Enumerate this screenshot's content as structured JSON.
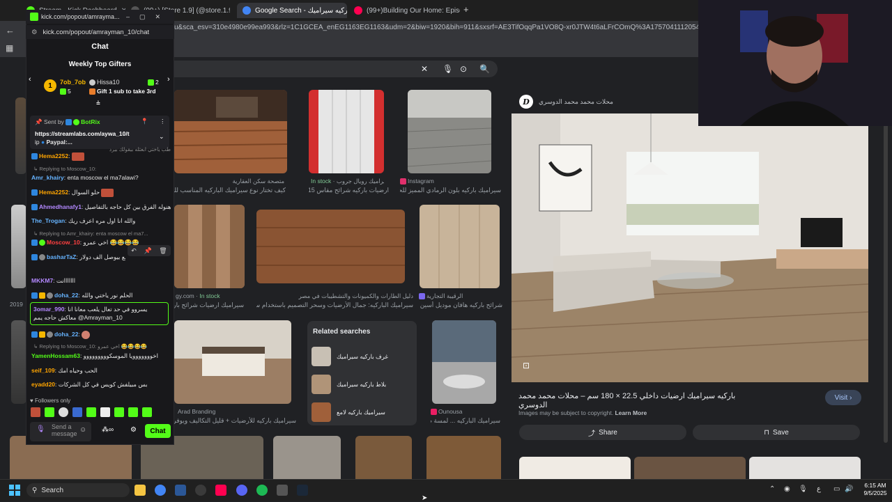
{
  "browser": {
    "tabs": [
      {
        "title": "Stream - Kick Dashboard",
        "color": "#53fc18"
      },
      {
        "title": "(99+) [Store 1.9] (@store.1.9) | Tik",
        "color": "#555"
      },
      {
        "title": "Google Search - باركيه سيراميك",
        "color": "#4285f4"
      },
      {
        "title": "(99+)Building Our Home: Episo",
        "color": "#ff0050"
      }
    ],
    "url": "u&sca_esv=310e4980e99ea993&rlz=1C1GCEA_enEG1163EG1163&udm=2&biw=1920&bih=911&sxsrf=AE3TifOqqPa1VO8Q-xr0JTW4t6aLFrCOmQ%3A1757041112054&ei=2FG6aPS"
  },
  "google": {
    "results": [
      {
        "caption": "كيف تختار نوع سيراميك الباركيه المناسب لك وكيف يتم ...",
        "source": "متصحة سكن العقارية"
      },
      {
        "caption": "ارضيات باركيه شرائح مقاس 15* ...",
        "source": "سيراميك رويال جروب",
        "badge": "In stock"
      },
      {
        "caption": "سيراميك باركيه بلون الرمادي المميز للحصول ...",
        "source": "Instagram"
      },
      {
        "caption": "سيراميك ارضيات شرائح باركيه ...",
        "source": "gy.com",
        "badge": "In stock"
      },
      {
        "caption": "سيراميك الباركيه: جمال الأرضيات وسحر التصميم باستخدام سيراميك ...",
        "source": "دليل الطارات والكميونات والتشطيبات في مصر"
      },
      {
        "caption": "شرائح باركيه هافان موديل أسين 5 ...",
        "source": "الرقيبة التجارية"
      },
      {
        "caption": "سيراميك باركيه للأرضيات + قليل التكاليف ويوفر المسا ...",
        "source": "Arad Branding"
      },
      {
        "caption": "سيراميك الباركيه ... لمسة م ...",
        "source": "Ounousa"
      }
    ],
    "left_edge_caption": "2019",
    "related": {
      "title": "Related searches",
      "items": [
        "غرف باركيه سيراميك",
        "بلاط باركيه سيراميك",
        "سيراميك باركيه لامع"
      ]
    },
    "preview": {
      "site_logo": "D",
      "site": "محلات محمد محمد الدوسري",
      "title": "باركيه سيراميك ارضيات داخلي 22.5 × 180 سم – محلات محمد محمد الدوسري",
      "visit": "Visit",
      "copyright": "Images may be subject to copyright.",
      "learn_more": "Learn More",
      "share": "Share",
      "save": "Save"
    }
  },
  "chat": {
    "window_title": "kick.com/popout/amrayma...",
    "url": "kick.com/popout/amrayman_10/chat",
    "header": "Chat",
    "gifters": {
      "title": "Weekly Top Gifters",
      "first": {
        "rank": "1",
        "name": "7ob_7ob",
        "count": "5"
      },
      "second": {
        "name": "Hissa10",
        "count": "2",
        "note": "Gift 1 sub to take 3rd"
      }
    },
    "pinned": {
      "sent_by": "Sent by",
      "bot": "BotRix",
      "link": "https://streamlabs.com/aywa_10/t",
      "rest": "ip",
      "paypal": "Paypal:..."
    },
    "messages": [
      {
        "type": "reply",
        "text": "طب ياختي ابعثله بيقولك بيرد"
      },
      {
        "type": "msg",
        "user": "Hema2252",
        "color": "#ffa500",
        "text": ""
      },
      {
        "type": "reply",
        "text": "Replying to Moscow_10:"
      },
      {
        "type": "msg",
        "user": "Amr_khairy",
        "color": "#66b3ff",
        "text": "enta moscow el ma7alawi?"
      },
      {
        "type": "msg",
        "user": "Hema2252",
        "color": "#ffa500",
        "text": "حلو السوال"
      },
      {
        "type": "msg",
        "user": "Ahmedhanafy1",
        "color": "#b388ff",
        "text": "هنوله الفرق بين كل حاجه بالتفاصيل"
      },
      {
        "type": "msg",
        "user": "The_Trogan",
        "color": "#66b3ff",
        "text": "والله انا اول مره اعرف ريك"
      },
      {
        "type": "reply",
        "text": "Replying to Amr_khairy: enta moscow el ma7..."
      },
      {
        "type": "msg",
        "user": "Moscow_10",
        "color": "#ff4040",
        "text": "اخي عمرو 😂😂😂😂"
      },
      {
        "type": "msg",
        "user": "basharTaZ",
        "color": "#66b3ff",
        "text": "اغلام الامبراطور الاسباني اسماره المتر المربع بيوصل الف دولار"
      },
      {
        "type": "msg",
        "user": "MKKM7",
        "color": "#b388ff",
        "text": "ااااااانت"
      },
      {
        "type": "msg",
        "user": "doha_22",
        "color": "#66b3ff",
        "text": "الحلم نور ياختي والله"
      },
      {
        "type": "msg",
        "user": "3omar_990",
        "color": "#b388ff",
        "text": "يسروو في حد تعال يلعب معانا انا معاكش حاجه يمم @Amrayman_10"
      },
      {
        "type": "msg",
        "user": "doha_22",
        "color": "#66b3ff",
        "text": ""
      },
      {
        "type": "reply",
        "text": "Replying to Moscow_10: اخي عمرو 😂😂😂😂"
      },
      {
        "type": "msg",
        "user": "YamenHossam63",
        "color": "#53fc18",
        "text": "اخووووووويا الموسكووووووووو"
      },
      {
        "type": "msg",
        "user": "seif_109",
        "color": "#ffa500",
        "text": "الحب وحياه امك"
      },
      {
        "type": "msg",
        "user": "eyadd20",
        "color": "#ffa500",
        "text": "بس مبيلفش كويس في كل الشركات"
      }
    ],
    "followers_only": "Followers only",
    "input_placeholder": "Send a message",
    "send": "Chat"
  },
  "taskbar": {
    "search": "Search",
    "time": "6:15 AM",
    "date": "9/5/2025",
    "lang": "ع"
  }
}
